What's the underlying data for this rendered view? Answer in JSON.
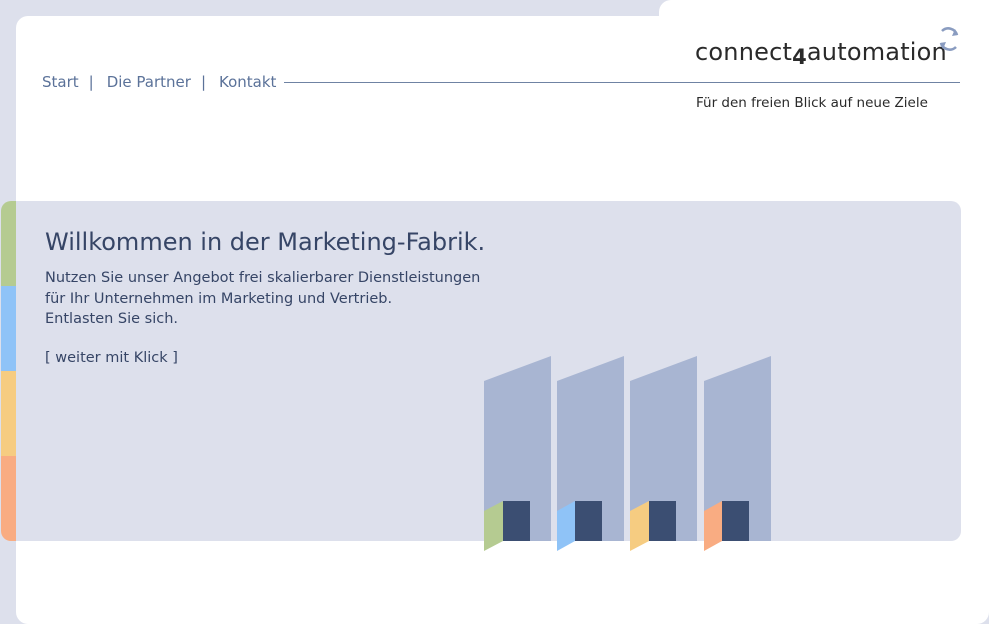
{
  "nav": {
    "items": [
      {
        "label": "Start"
      },
      {
        "label": "Die Partner"
      },
      {
        "label": "Kontakt"
      }
    ],
    "separator": "|"
  },
  "brand": {
    "name_part1": "connect",
    "name_digit": "4",
    "name_part2": "automation",
    "tagline": "Für den freien Blick auf neue Ziele"
  },
  "banner": {
    "headline": "Willkommen in der Marketing-Fabrik.",
    "lines": [
      "Nutzen Sie unser Angebot frei skalierbarer Dienstleistungen",
      "für Ihr Unternehmen im Marketing und Vertrieb.",
      "Entlasten Sie sich."
    ],
    "more_link": "[ weiter mit Klick ]"
  },
  "colors": {
    "stripe_green": "#b5cb91",
    "stripe_blue": "#8fc3f7",
    "stripe_yellow": "#f6cc81",
    "stripe_orange": "#f9ac82",
    "panel_blue": "#a8b5d2",
    "dark_block": "#3b4e72",
    "text": "#364566"
  }
}
